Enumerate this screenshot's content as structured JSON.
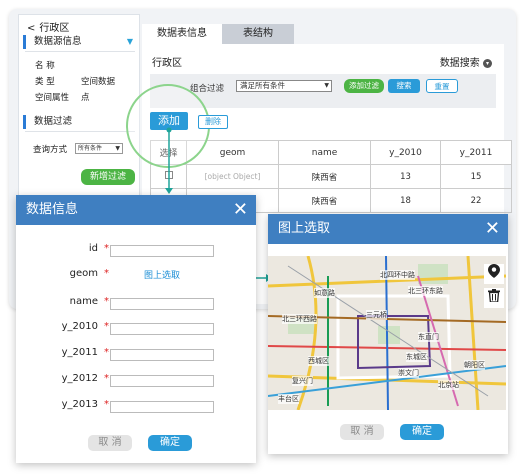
{
  "sidebar": {
    "back_arrow": "<",
    "title": "行政区",
    "section1": "数据源信息",
    "section1_caret": "▼",
    "rows": [
      {
        "label": "名 称",
        "value": ""
      },
      {
        "label": "类 型",
        "value": "空间数据"
      },
      {
        "label": "空间属性",
        "value": "点"
      }
    ],
    "section2": "数据过滤",
    "query_label": "查询方式",
    "query_value": "所有条件",
    "add_filter": "新增过滤"
  },
  "tabs": [
    {
      "label": "数据表信息"
    },
    {
      "label": "表结构"
    }
  ],
  "main": {
    "title": "行政区",
    "search_label": "数据搜索",
    "filter_label": "组合过滤",
    "filter_value": "满足所有条件",
    "add_filter_btn": "添加过滤",
    "search_btn": "搜索",
    "reset_btn": "重置",
    "add_btn": "添加",
    "delete_btn": "删除"
  },
  "table": {
    "headers": [
      "选择",
      "geom",
      "name",
      "y_2010",
      "y_2011"
    ],
    "rows": [
      {
        "geom": "[object Object]",
        "name": "陕西省",
        "y_2010": "13",
        "y_2011": "15"
      },
      {
        "geom": "",
        "name": "陕西省",
        "y_2010": "18",
        "y_2011": "22"
      }
    ]
  },
  "data_dialog": {
    "title": "数据信息",
    "close": "✕",
    "fields": [
      {
        "label": "id",
        "star": "*"
      },
      {
        "label": "geom",
        "star": "*",
        "link": "图上选取"
      },
      {
        "label": "name",
        "star": "*"
      },
      {
        "label": "y_2010",
        "star": "*"
      },
      {
        "label": "y_2011",
        "star": "*"
      },
      {
        "label": "y_2012",
        "star": "*"
      },
      {
        "label": "y_2013",
        "star": "*"
      }
    ],
    "cancel": "取 消",
    "ok": "确定"
  },
  "map_dialog": {
    "title": "图上选取",
    "close": "✕",
    "labels": [
      "北四环中路",
      "如意路",
      "北三环西路",
      "北三环东路",
      "三元桥",
      "东直门",
      "东城区",
      "西城区",
      "崇文门",
      "朝阳区",
      "复兴门",
      "北京站",
      "丰台区"
    ],
    "cancel": "取 消",
    "ok": "确定"
  },
  "colors": {
    "accent": "#2a9bd8",
    "header_blue": "#3f7fc1",
    "green": "#4cb444",
    "teal_connector": "#1fa49a"
  }
}
